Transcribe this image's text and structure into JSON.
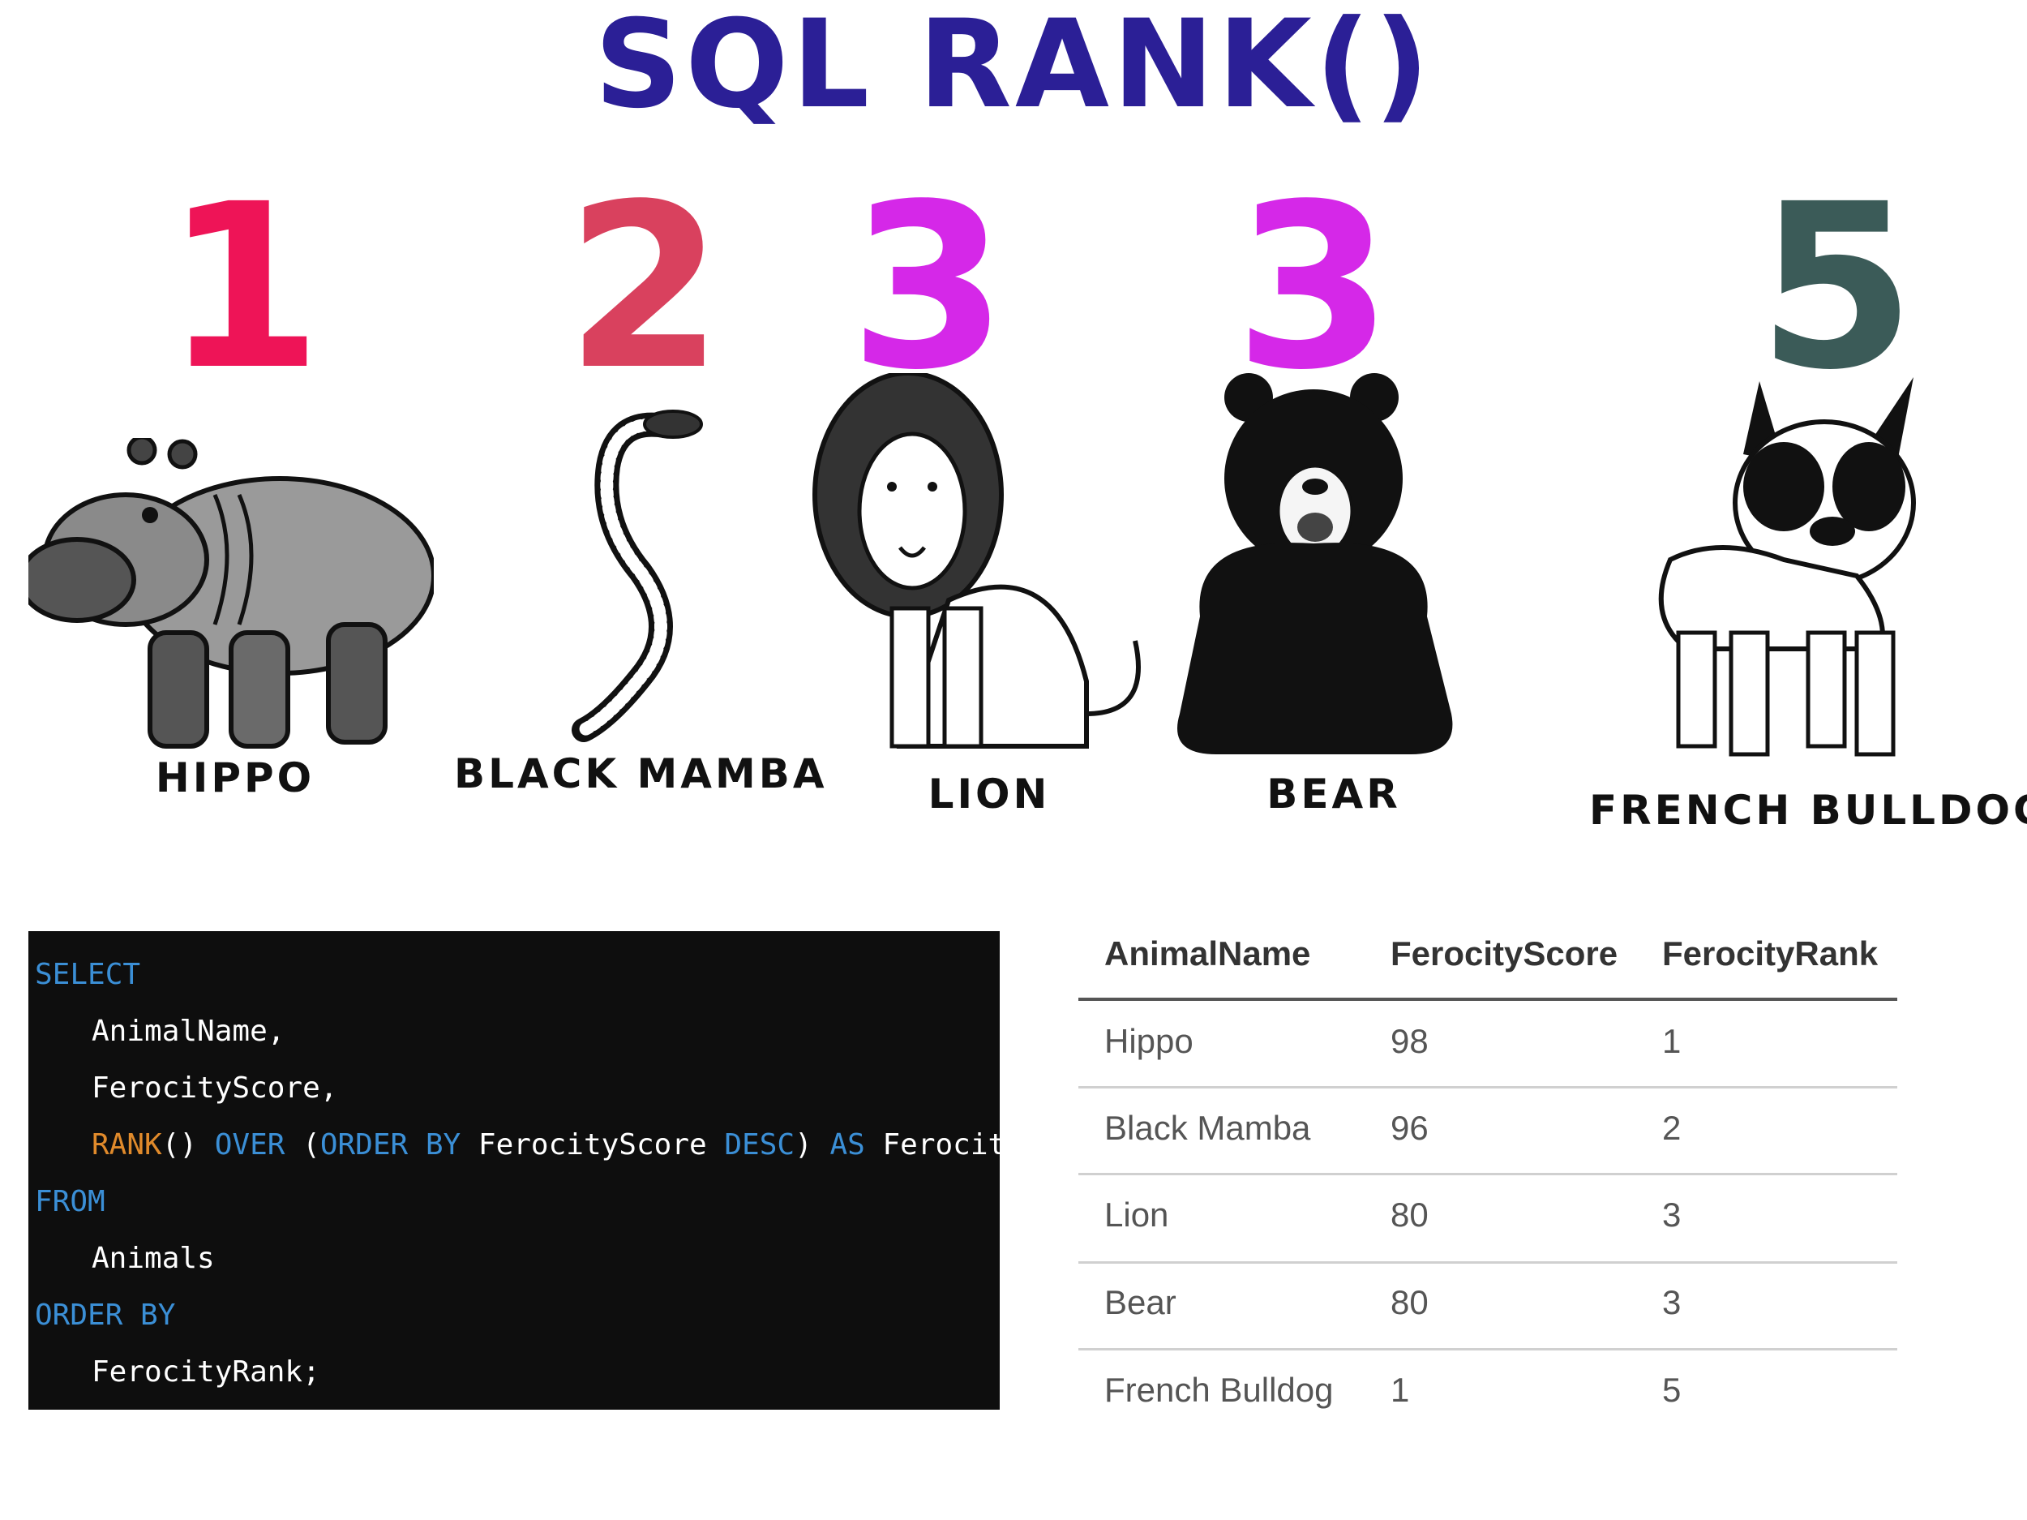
{
  "title": "SQL RANK()",
  "ranks": [
    {
      "value": "1",
      "color": "#ee1457"
    },
    {
      "value": "2",
      "color": "#d9415e"
    },
    {
      "value": "3",
      "color": "#d528e8"
    },
    {
      "value": "3",
      "color": "#d528e8"
    },
    {
      "value": "5",
      "color": "#3b5b58"
    }
  ],
  "animals": [
    {
      "label": "HIPPO",
      "icon": "hippo-icon"
    },
    {
      "label": "BLACK MAMBA",
      "icon": "snake-icon"
    },
    {
      "label": "LION",
      "icon": "lion-icon"
    },
    {
      "label": "BEAR",
      "icon": "bear-icon"
    },
    {
      "label": "FRENCH BULLDOG",
      "icon": "bulldog-icon"
    }
  ],
  "code": {
    "select": "SELECT",
    "col1": "AnimalName,",
    "col2": "FerocityScore,",
    "rank_fn": "RANK",
    "rank_parens": "()",
    "over": "OVER",
    "open_paren": "(",
    "order_by_inner": "ORDER BY",
    "score_col": "FerocityScore",
    "desc": "DESC",
    "close_paren": ")",
    "as": "AS",
    "alias": "FerocityRank",
    "from": "FROM",
    "table": "Animals",
    "order_by": "ORDER BY",
    "order_col": "FerocityRank;"
  },
  "table": {
    "headers": [
      "AnimalName",
      "FerocityScore",
      "FerocityRank"
    ],
    "rows": [
      [
        "Hippo",
        "98",
        "1"
      ],
      [
        "Black Mamba",
        "96",
        "2"
      ],
      [
        "Lion",
        "80",
        "3"
      ],
      [
        "Bear",
        "80",
        "3"
      ],
      [
        "French Bulldog",
        "1",
        "5"
      ]
    ]
  }
}
